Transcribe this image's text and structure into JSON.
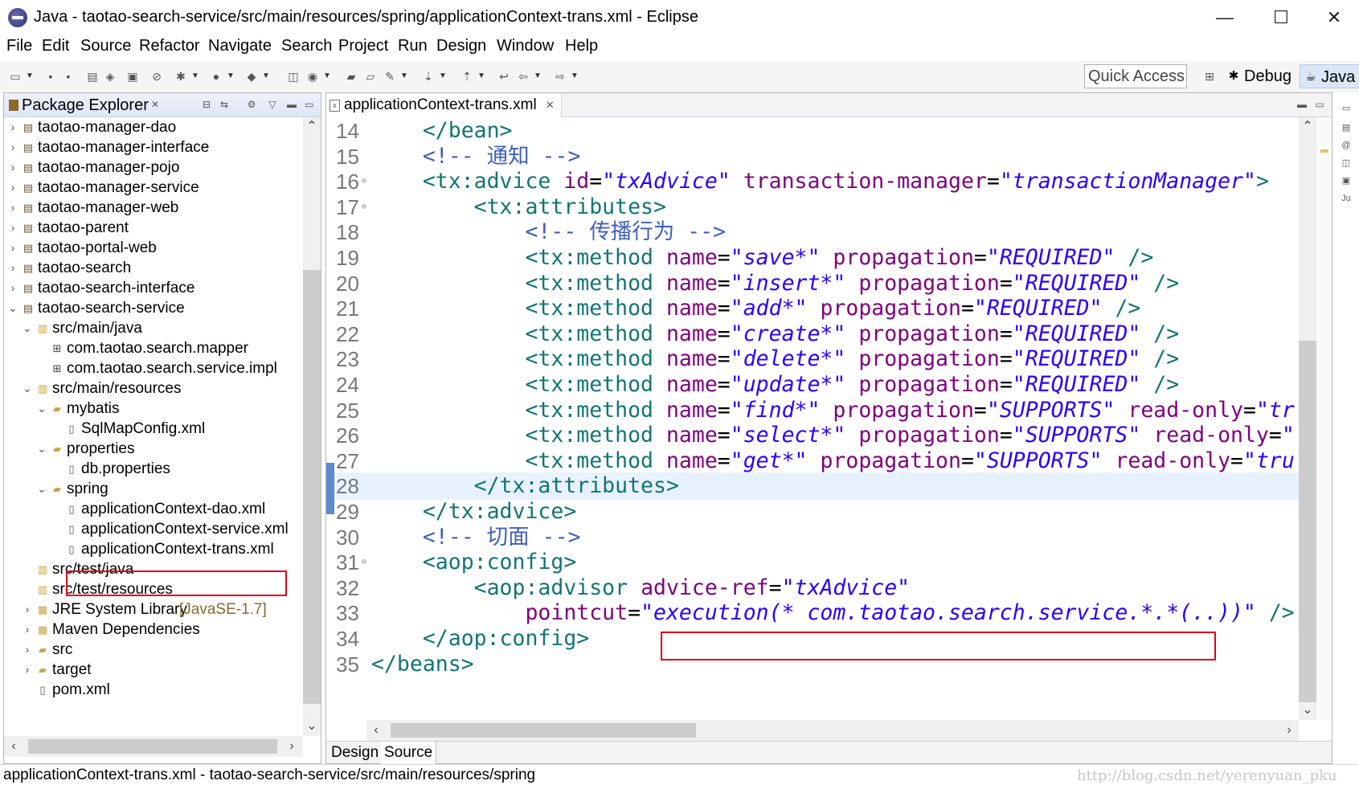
{
  "window": {
    "title": "Java - taotao-search-service/src/main/resources/spring/applicationContext-trans.xml - Eclipse",
    "minimize": "—",
    "maximize": "☐",
    "close": "✕"
  },
  "menubar": [
    "File",
    "Edit",
    "Source",
    "Refactor",
    "Navigate",
    "Search",
    "Project",
    "Run",
    "Design",
    "Window",
    "Help"
  ],
  "toolbar": {
    "quick_access_placeholder": "Quick Access",
    "perspectives": [
      "Debug",
      "Java"
    ]
  },
  "package_explorer": {
    "title": "Package Explorer",
    "items": [
      {
        "label": "taotao-manager-dao",
        "kind": "project",
        "expanded": false
      },
      {
        "label": "taotao-manager-interface",
        "kind": "project",
        "expanded": false
      },
      {
        "label": "taotao-manager-pojo",
        "kind": "project",
        "expanded": false
      },
      {
        "label": "taotao-manager-service",
        "kind": "project",
        "expanded": false
      },
      {
        "label": "taotao-manager-web",
        "kind": "project",
        "expanded": false
      },
      {
        "label": "taotao-parent",
        "kind": "project",
        "expanded": false
      },
      {
        "label": "taotao-portal-web",
        "kind": "project",
        "expanded": false
      },
      {
        "label": "taotao-search",
        "kind": "project",
        "expanded": false
      },
      {
        "label": "taotao-search-interface",
        "kind": "project",
        "expanded": false
      },
      {
        "label": "taotao-search-service",
        "kind": "project",
        "expanded": true
      },
      {
        "label": "src/main/java",
        "kind": "source-folder",
        "expanded": true
      },
      {
        "label": "com.taotao.search.mapper",
        "kind": "package"
      },
      {
        "label": "com.taotao.search.service.impl",
        "kind": "package"
      },
      {
        "label": "src/main/resources",
        "kind": "source-folder",
        "expanded": true
      },
      {
        "label": "mybatis",
        "kind": "folder",
        "expanded": true
      },
      {
        "label": "SqlMapConfig.xml",
        "kind": "xml-file"
      },
      {
        "label": "properties",
        "kind": "folder",
        "expanded": true
      },
      {
        "label": "db.properties",
        "kind": "properties-file"
      },
      {
        "label": "spring",
        "kind": "folder",
        "expanded": true
      },
      {
        "label": "applicationContext-dao.xml",
        "kind": "xml-file"
      },
      {
        "label": "applicationContext-service.xml",
        "kind": "xml-file"
      },
      {
        "label": "applicationContext-trans.xml",
        "kind": "xml-file",
        "selected": true
      },
      {
        "label": "src/test/java",
        "kind": "source-folder"
      },
      {
        "label": "src/test/resources",
        "kind": "source-folder"
      },
      {
        "label": "JRE System Library",
        "decoration": "[JavaSE-1.7]",
        "kind": "library",
        "expanded": false
      },
      {
        "label": "Maven Dependencies",
        "kind": "library",
        "expanded": false
      },
      {
        "label": "src",
        "kind": "folder",
        "expanded": false
      },
      {
        "label": "target",
        "kind": "folder",
        "expanded": false
      },
      {
        "label": "pom.xml",
        "kind": "xml-file"
      }
    ]
  },
  "editor": {
    "tab_label": "applicationContext-trans.xml",
    "current_line": 28,
    "lines": [
      {
        "n": "14",
        "segs": [
          [
            "sym",
            "    "
          ],
          [
            "tag",
            "</bean>"
          ]
        ]
      },
      {
        "n": "15",
        "segs": [
          [
            "sym",
            "    "
          ],
          [
            "com",
            "<!-- 通知 -->"
          ]
        ]
      },
      {
        "n": "16",
        "fold": true,
        "segs": [
          [
            "sym",
            "    "
          ],
          [
            "tag",
            "<tx:advice "
          ],
          [
            "attr",
            "id"
          ],
          [
            "sym",
            "="
          ],
          [
            "str",
            "\"txAdvice\""
          ],
          [
            "sym",
            " "
          ],
          [
            "attr",
            "transaction-manager"
          ],
          [
            "sym",
            "="
          ],
          [
            "str",
            "\"transactionManager\""
          ],
          [
            "tag",
            ">"
          ]
        ]
      },
      {
        "n": "17",
        "fold": true,
        "segs": [
          [
            "sym",
            "        "
          ],
          [
            "tag",
            "<tx:attributes>"
          ]
        ]
      },
      {
        "n": "18",
        "segs": [
          [
            "sym",
            "            "
          ],
          [
            "com",
            "<!-- 传播行为 -->"
          ]
        ]
      },
      {
        "n": "19",
        "segs": [
          [
            "sym",
            "            "
          ],
          [
            "tag",
            "<tx:method "
          ],
          [
            "attr",
            "name"
          ],
          [
            "sym",
            "="
          ],
          [
            "str",
            "\"save*\""
          ],
          [
            "sym",
            " "
          ],
          [
            "attr",
            "propagation"
          ],
          [
            "sym",
            "="
          ],
          [
            "str",
            "\"REQUIRED\""
          ],
          [
            "sym",
            " "
          ],
          [
            "tag",
            "/>"
          ]
        ]
      },
      {
        "n": "20",
        "segs": [
          [
            "sym",
            "            "
          ],
          [
            "tag",
            "<tx:method "
          ],
          [
            "attr",
            "name"
          ],
          [
            "sym",
            "="
          ],
          [
            "str",
            "\"insert*\""
          ],
          [
            "sym",
            " "
          ],
          [
            "attr",
            "propagation"
          ],
          [
            "sym",
            "="
          ],
          [
            "str",
            "\"REQUIRED\""
          ],
          [
            "sym",
            " "
          ],
          [
            "tag",
            "/>"
          ]
        ]
      },
      {
        "n": "21",
        "segs": [
          [
            "sym",
            "            "
          ],
          [
            "tag",
            "<tx:method "
          ],
          [
            "attr",
            "name"
          ],
          [
            "sym",
            "="
          ],
          [
            "str",
            "\"add*\""
          ],
          [
            "sym",
            " "
          ],
          [
            "attr",
            "propagation"
          ],
          [
            "sym",
            "="
          ],
          [
            "str",
            "\"REQUIRED\""
          ],
          [
            "sym",
            " "
          ],
          [
            "tag",
            "/>"
          ]
        ]
      },
      {
        "n": "22",
        "segs": [
          [
            "sym",
            "            "
          ],
          [
            "tag",
            "<tx:method "
          ],
          [
            "attr",
            "name"
          ],
          [
            "sym",
            "="
          ],
          [
            "str",
            "\"create*\""
          ],
          [
            "sym",
            " "
          ],
          [
            "attr",
            "propagation"
          ],
          [
            "sym",
            "="
          ],
          [
            "str",
            "\"REQUIRED\""
          ],
          [
            "sym",
            " "
          ],
          [
            "tag",
            "/>"
          ]
        ]
      },
      {
        "n": "23",
        "segs": [
          [
            "sym",
            "            "
          ],
          [
            "tag",
            "<tx:method "
          ],
          [
            "attr",
            "name"
          ],
          [
            "sym",
            "="
          ],
          [
            "str",
            "\"delete*\""
          ],
          [
            "sym",
            " "
          ],
          [
            "attr",
            "propagation"
          ],
          [
            "sym",
            "="
          ],
          [
            "str",
            "\"REQUIRED\""
          ],
          [
            "sym",
            " "
          ],
          [
            "tag",
            "/>"
          ]
        ]
      },
      {
        "n": "24",
        "segs": [
          [
            "sym",
            "            "
          ],
          [
            "tag",
            "<tx:method "
          ],
          [
            "attr",
            "name"
          ],
          [
            "sym",
            "="
          ],
          [
            "str",
            "\"update*\""
          ],
          [
            "sym",
            " "
          ],
          [
            "attr",
            "propagation"
          ],
          [
            "sym",
            "="
          ],
          [
            "str",
            "\"REQUIRED\""
          ],
          [
            "sym",
            " "
          ],
          [
            "tag",
            "/>"
          ]
        ]
      },
      {
        "n": "25",
        "segs": [
          [
            "sym",
            "            "
          ],
          [
            "tag",
            "<tx:method "
          ],
          [
            "attr",
            "name"
          ],
          [
            "sym",
            "="
          ],
          [
            "str",
            "\"find*\""
          ],
          [
            "sym",
            " "
          ],
          [
            "attr",
            "propagation"
          ],
          [
            "sym",
            "="
          ],
          [
            "str",
            "\"SUPPORTS\""
          ],
          [
            "sym",
            " "
          ],
          [
            "attr",
            "read-only"
          ],
          [
            "sym",
            "="
          ],
          [
            "str",
            "\"tr"
          ]
        ]
      },
      {
        "n": "26",
        "segs": [
          [
            "sym",
            "            "
          ],
          [
            "tag",
            "<tx:method "
          ],
          [
            "attr",
            "name"
          ],
          [
            "sym",
            "="
          ],
          [
            "str",
            "\"select*\""
          ],
          [
            "sym",
            " "
          ],
          [
            "attr",
            "propagation"
          ],
          [
            "sym",
            "="
          ],
          [
            "str",
            "\"SUPPORTS\""
          ],
          [
            "sym",
            " "
          ],
          [
            "attr",
            "read-only"
          ],
          [
            "sym",
            "="
          ],
          [
            "str",
            "\""
          ]
        ]
      },
      {
        "n": "27",
        "segs": [
          [
            "sym",
            "            "
          ],
          [
            "tag",
            "<tx:method "
          ],
          [
            "attr",
            "name"
          ],
          [
            "sym",
            "="
          ],
          [
            "str",
            "\"get*\""
          ],
          [
            "sym",
            " "
          ],
          [
            "attr",
            "propagation"
          ],
          [
            "sym",
            "="
          ],
          [
            "str",
            "\"SUPPORTS\""
          ],
          [
            "sym",
            " "
          ],
          [
            "attr",
            "read-only"
          ],
          [
            "sym",
            "="
          ],
          [
            "str",
            "\"tru"
          ]
        ]
      },
      {
        "n": "28",
        "segs": [
          [
            "sym",
            "        "
          ],
          [
            "tag",
            "</tx:attributes>"
          ]
        ]
      },
      {
        "n": "29",
        "segs": [
          [
            "sym",
            "    "
          ],
          [
            "tag",
            "</tx:advice>"
          ]
        ]
      },
      {
        "n": "30",
        "segs": [
          [
            "sym",
            "    "
          ],
          [
            "com",
            "<!-- 切面 -->"
          ]
        ]
      },
      {
        "n": "31",
        "fold": true,
        "segs": [
          [
            "sym",
            "    "
          ],
          [
            "tag",
            "<aop:config>"
          ]
        ]
      },
      {
        "n": "32",
        "segs": [
          [
            "sym",
            "        "
          ],
          [
            "tag",
            "<aop:advisor "
          ],
          [
            "attr",
            "advice-ref"
          ],
          [
            "sym",
            "="
          ],
          [
            "str",
            "\"txAdvice\""
          ]
        ]
      },
      {
        "n": "33",
        "segs": [
          [
            "sym",
            "            "
          ],
          [
            "attr",
            "pointcut"
          ],
          [
            "sym",
            "="
          ],
          [
            "str",
            "\"execution(* com.taotao.search.service.*.*(..))\""
          ],
          [
            "sym",
            " "
          ],
          [
            "tag",
            "/>"
          ]
        ]
      },
      {
        "n": "34",
        "segs": [
          [
            "sym",
            "    "
          ],
          [
            "tag",
            "</aop:config>"
          ]
        ]
      },
      {
        "n": "35",
        "segs": [
          [
            "tag",
            "</beans>"
          ]
        ]
      }
    ],
    "bottom_tabs": [
      "Design",
      "Source"
    ],
    "active_bottom_tab": "Source"
  },
  "status_bar": {
    "text": "applicationContext-trans.xml - taotao-search-service/src/main/resources/spring",
    "watermark": "http://blog.csdn.net/yerenyuan_pku"
  },
  "colors": {
    "tag": "#127575",
    "attribute": "#7f007f",
    "string": "#2a00ff",
    "comment": "#3f5fbf",
    "highlight_box": "#e0001a",
    "current_line": "#e8f2fe"
  }
}
